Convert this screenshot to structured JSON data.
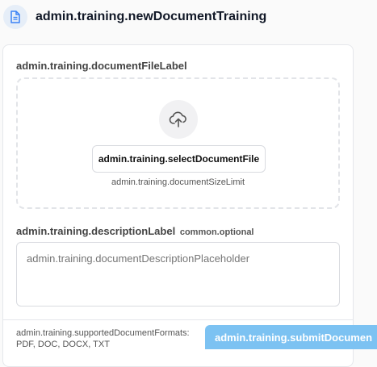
{
  "header": {
    "title": "admin.training.newDocumentTraining",
    "icon": "document-icon"
  },
  "upload": {
    "label": "admin.training.documentFileLabel",
    "icon": "cloud-upload-icon",
    "select_button": "admin.training.selectDocumentFile",
    "size_limit": "admin.training.documentSizeLimit"
  },
  "description": {
    "label": "admin.training.descriptionLabel",
    "optional": "common.optional",
    "placeholder": "admin.training.documentDescriptionPlaceholder"
  },
  "footer": {
    "formats_label": "admin.training.supportedDocumentFormats:",
    "formats_value": "PDF, DOC, DOCX, TXT",
    "submit_button": "admin.training.submitDocumen"
  },
  "colors": {
    "accent": "#7cc2f2",
    "icon_blue": "#3b82f6"
  }
}
